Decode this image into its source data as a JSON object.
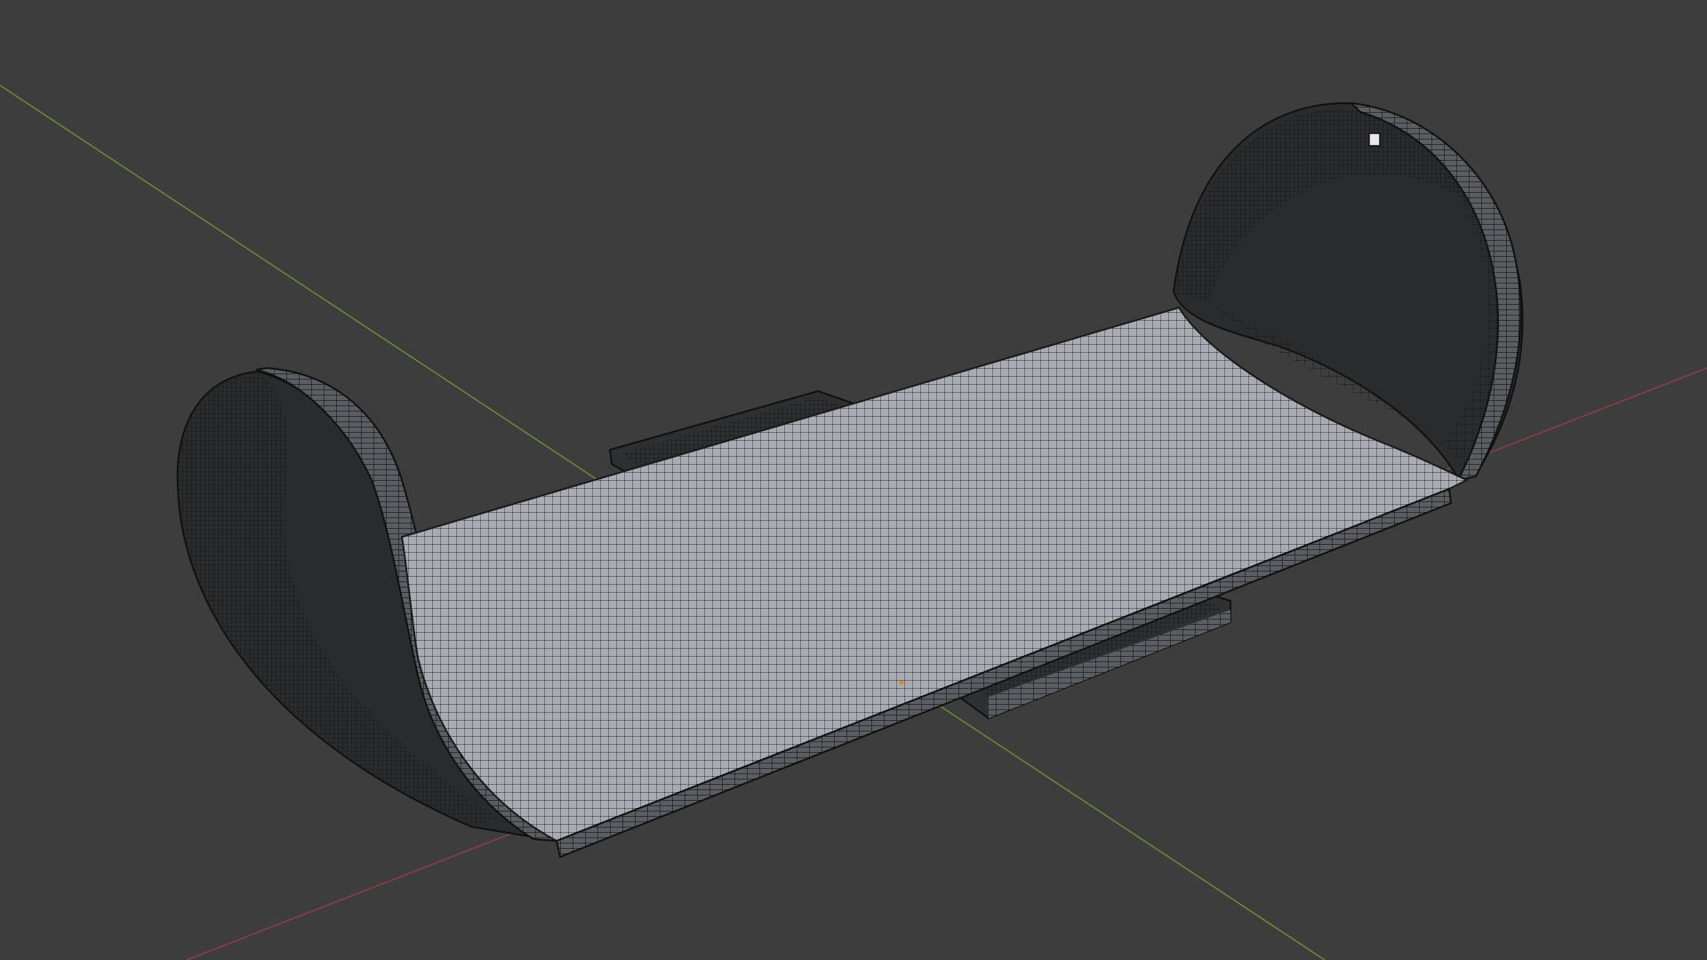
{
  "viewport": {
    "mode": "edit-mode-wireframe",
    "background_color": "#3d3d3d",
    "axes": {
      "x_axis_color": "#8a3f46",
      "y_axis_color": "#6a8a34"
    },
    "mesh": {
      "name": "curved-board-mesh",
      "face_color": "#a8acb2",
      "edge_color": "#1a1a1a",
      "vertex_color": "#111111",
      "selected_vertex_color": "#e08a1a",
      "shadow_color": "#2b2b2b"
    }
  }
}
